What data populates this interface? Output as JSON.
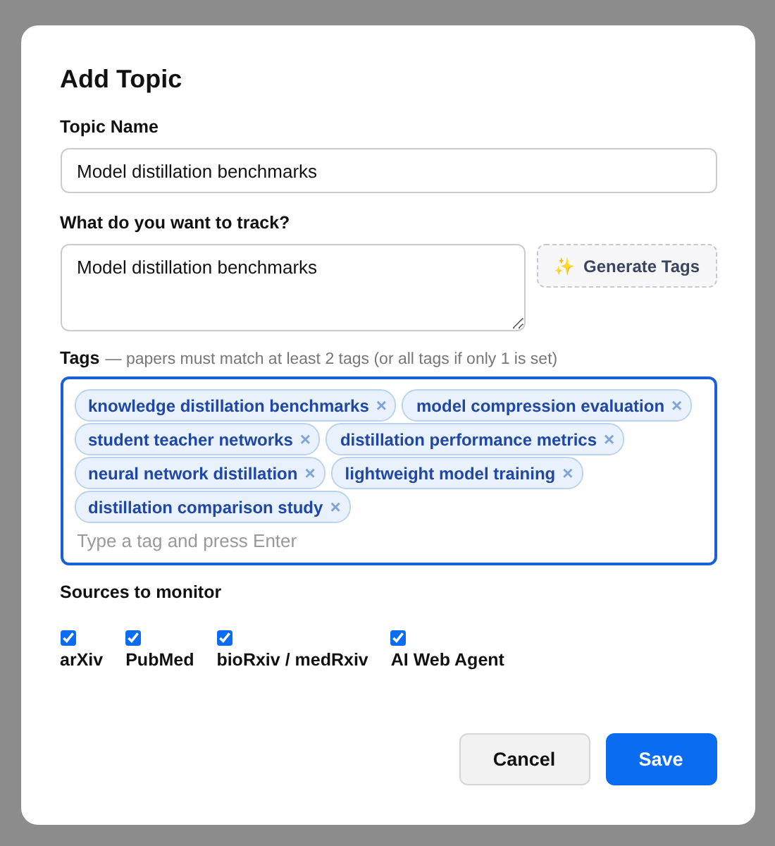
{
  "dialog": {
    "title": "Add Topic",
    "topic_name": {
      "label": "Topic Name",
      "value": "Model distillation benchmarks"
    },
    "track": {
      "label": "What do you want to track?",
      "value": "Model distillation benchmarks"
    },
    "generate_button": {
      "icon": "✨",
      "label": "Generate Tags"
    },
    "tags": {
      "label": "Tags",
      "hint": "— papers must match at least 2 tags (or all tags if only 1 is set)",
      "focused": true,
      "items": [
        {
          "label": "knowledge distillation benchmarks",
          "remove": "×"
        },
        {
          "label": "model compression evaluation",
          "remove": "×"
        },
        {
          "label": "student teacher networks",
          "remove": "×"
        },
        {
          "label": "distillation performance metrics",
          "remove": "×"
        },
        {
          "label": "neural network distillation",
          "remove": "×"
        },
        {
          "label": "lightweight model training",
          "remove": "×"
        },
        {
          "label": "distillation comparison study",
          "remove": "×"
        }
      ],
      "placeholder": "Type a tag and press Enter"
    },
    "sources": {
      "label": "Sources to monitor",
      "items": [
        {
          "label": "arXiv",
          "checked": true
        },
        {
          "label": "PubMed",
          "checked": true
        },
        {
          "label": "bioRxiv / medRxiv",
          "checked": true
        },
        {
          "label": "AI Web Agent",
          "checked": true
        }
      ]
    },
    "buttons": [
      {
        "label": "Cancel",
        "kind": "secondary"
      },
      {
        "label": "Save",
        "kind": "primary"
      }
    ]
  }
}
